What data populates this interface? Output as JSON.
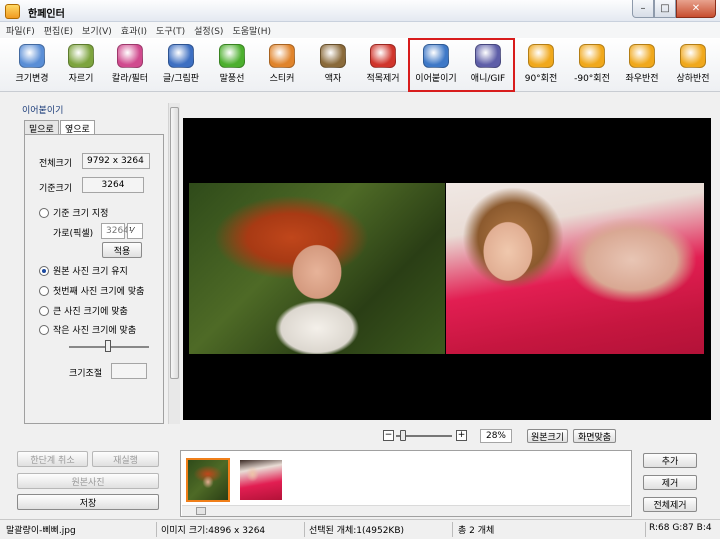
{
  "window": {
    "title": "한페인터",
    "controls": [
      "–",
      "□",
      "✕"
    ]
  },
  "menu": [
    "파일(F)",
    "편집(E)",
    "보기(V)",
    "효과(I)",
    "도구(T)",
    "설정(S)",
    "도움말(H)"
  ],
  "toolbar": [
    {
      "label": "크기변경",
      "icon": "resize-icon",
      "color": "#5a8ed6"
    },
    {
      "label": "자르기",
      "icon": "crop-icon",
      "color": "#7da43e"
    },
    {
      "label": "칼라/필터",
      "icon": "color-filter-icon",
      "color": "#d04a8e"
    },
    {
      "label": "글/그림판",
      "icon": "text-draw-icon",
      "color": "#3d6fc2"
    },
    {
      "label": "말풍선",
      "icon": "speech-bubble-icon",
      "color": "#4caf2e"
    },
    {
      "label": "스티커",
      "icon": "sticker-icon",
      "color": "#e0842c"
    },
    {
      "label": "액자",
      "icon": "frame-icon",
      "color": "#8a6a3a"
    },
    {
      "label": "적목제거",
      "icon": "redeye-icon",
      "color": "#d0352c"
    },
    {
      "label": "이어붙이기",
      "icon": "merge-icon",
      "color": "#3e78c7"
    },
    {
      "label": "애니/GIF",
      "icon": "gif-icon",
      "color": "#5e5ea8"
    },
    {
      "label": "90°회전",
      "icon": "rotate-90-icon",
      "color": "#f0a81c"
    },
    {
      "label": "-90°회전",
      "icon": "rotate-minus-90-icon",
      "color": "#f0a81c"
    },
    {
      "label": "좌우반전",
      "icon": "flip-horizontal-icon",
      "color": "#f0a81c"
    },
    {
      "label": "상하반전",
      "icon": "flip-vertical-icon",
      "color": "#f0a81c"
    }
  ],
  "panel": {
    "title": "이어붙이기",
    "tabs": [
      "밑으로",
      "옆으로"
    ],
    "total_size_label": "전체크기",
    "total_size_value": "9792 x 3264",
    "base_size_label": "기준크기",
    "base_size_value": "3264",
    "option_set_base": "기준 크기 지정",
    "width_label": "가로(픽셀)",
    "width_value": "3264",
    "apply_label": "적용",
    "option_keep_original": "원본 사진 크기 유지",
    "option_fit_first": "첫번째 사진 크기에 맞춤",
    "option_fit_large": "큰 사진 크기에 맞춤",
    "option_fit_small": "작은 사진 크기에 맞춤",
    "adjust_label": "크기조절"
  },
  "bottom_left": {
    "undo_label": "한단계 취소",
    "redo_label": "재실행",
    "original_label": "원본사진",
    "save_label": "저장"
  },
  "zoom": {
    "minus": "−",
    "plus": "+",
    "value": "28%",
    "level": 0.05,
    "original_size_label": "원본크기",
    "fit_screen_label": "화면맞춤"
  },
  "right_buttons": {
    "add_label": "추가",
    "remove_label": "제거",
    "remove_all_label": "전체제거"
  },
  "status": {
    "filename": "말괄량이-삐삐.jpg",
    "image_size": "이미지 크기:4896 x 3264",
    "selected": "선택된 개체:1(4952KB)",
    "total": "총 2 개체",
    "rgb": "R:68 G:87 B:4"
  },
  "colors": {
    "highlight": "#d81c1c",
    "selected_thumb": "#f07f1a",
    "canvas": "#000000"
  }
}
